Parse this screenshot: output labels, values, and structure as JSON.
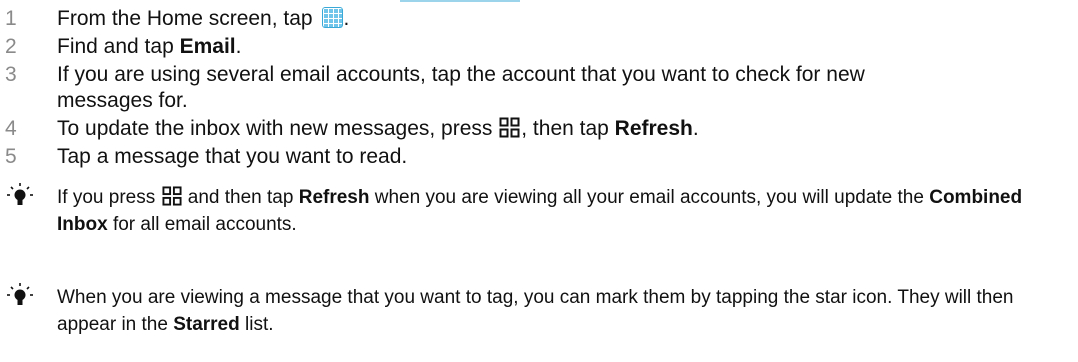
{
  "steps": [
    {
      "number": "1",
      "text": "From the Home screen, tap",
      "tail": ".",
      "icon": "apps-grid-icon"
    },
    {
      "number": "2",
      "text": "Find and tap ",
      "bold": "Email",
      "tail": "."
    },
    {
      "number": "3",
      "text": "If you are using several email accounts, tap the account that you want to check for new messages for."
    },
    {
      "number": "4",
      "text_before": "To update the inbox with new messages, press",
      "text_mid": ", then tap ",
      "bold": "Refresh",
      "tail": ".",
      "icon": "menu-icon"
    },
    {
      "number": "5",
      "text": "Tap a message that you want to read."
    }
  ],
  "tips": [
    {
      "icon": "lightbulb-icon",
      "part1": "If you press",
      "part2": " and then tap ",
      "bold1": "Refresh",
      "part3": " when you are viewing all your email accounts, you will update the ",
      "bold2": "Combined Inbox",
      "part4": " for all email accounts."
    },
    {
      "icon": "lightbulb-icon",
      "part1": "When you are viewing a message that you want to tag, you can mark them by tapping the star icon. They will then appear in the ",
      "bold1": "Starred",
      "part2": " list."
    }
  ],
  "colors": {
    "accent": "#3aa9d8",
    "step_number": "#8a8a8a",
    "text": "#111111"
  }
}
